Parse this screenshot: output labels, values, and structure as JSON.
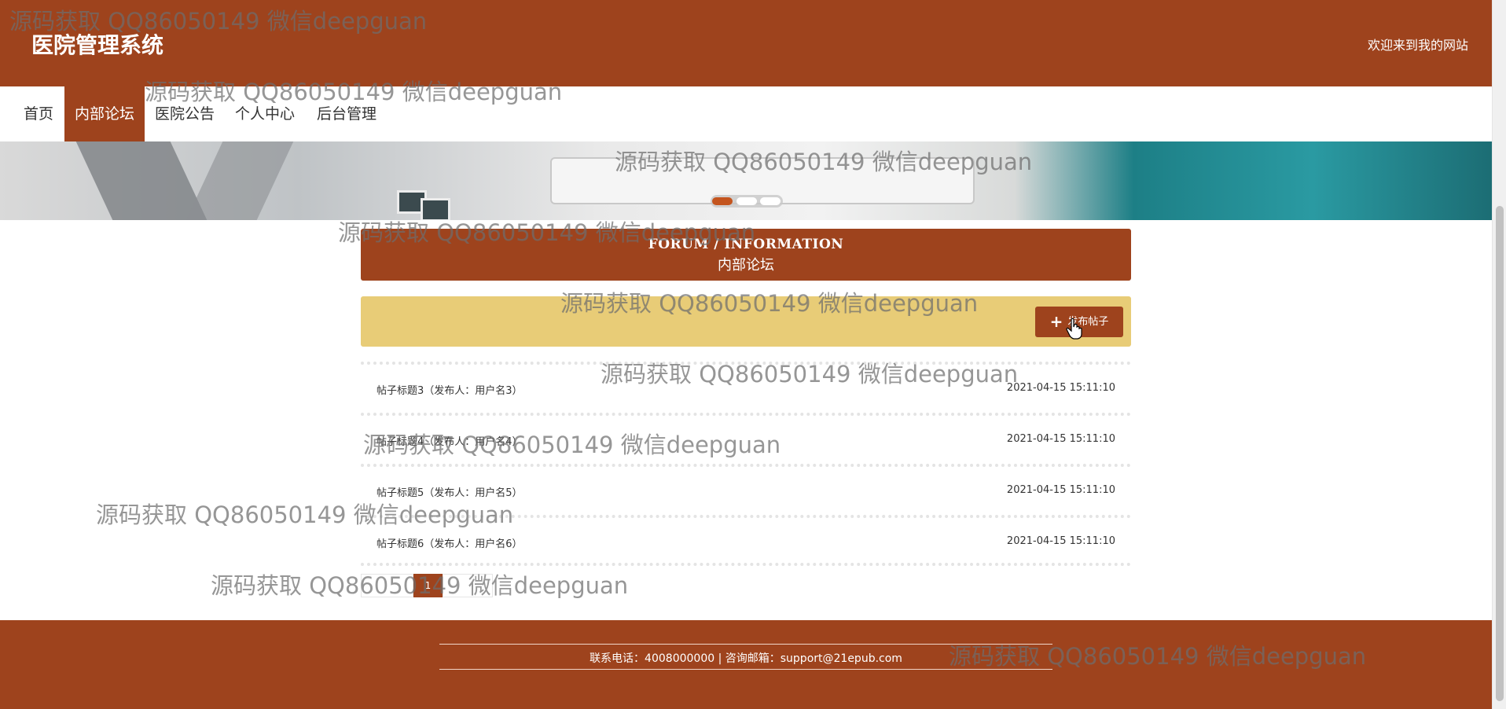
{
  "header": {
    "site_title": "医院管理系统",
    "welcome": "欢迎来到我的网站"
  },
  "nav": {
    "items": [
      "首页",
      "内部论坛",
      "医院公告",
      "个人中心",
      "后台管理"
    ],
    "active": "内部论坛"
  },
  "forum": {
    "heading_en": "FORUM / INFORMATION",
    "heading_cn": "内部论坛",
    "publish_label": "发布帖子"
  },
  "posts": [
    {
      "title": "帖子标题3（发布人：用户名3）",
      "time": "2021-04-15 15:11:10"
    },
    {
      "title": "帖子标题4（发布人：用户名4）",
      "time": "2021-04-15 15:11:10"
    },
    {
      "title": "帖子标题5（发布人：用户名5）",
      "time": "2021-04-15 15:11:10"
    },
    {
      "title": "帖子标题6（发布人：用户名6）",
      "time": "2021-04-15 15:11:10"
    }
  ],
  "pagination": {
    "current": "1"
  },
  "footer": {
    "contact": "联系电话：4008000000 | 咨询邮箱：support@21epub.com"
  },
  "watermark": "源码获取 QQ86050149 微信deepguan",
  "colors": {
    "primary": "#9e431d",
    "toolbar": "#e8cc77",
    "dot_active": "#c4551f"
  }
}
